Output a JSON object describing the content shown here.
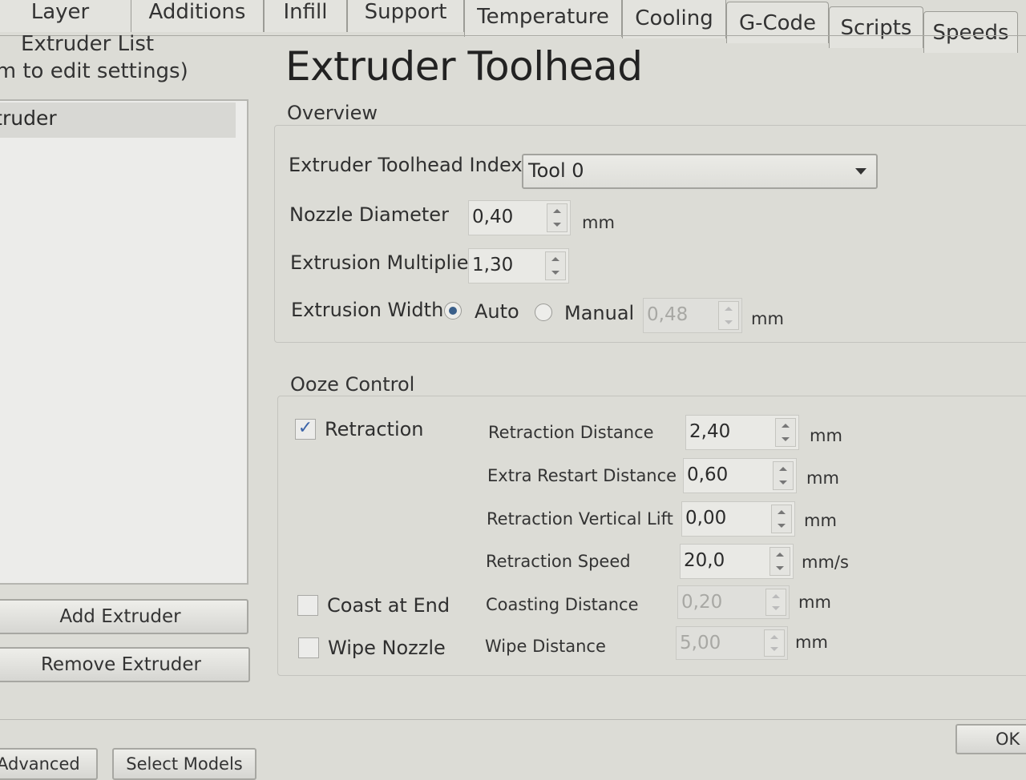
{
  "tabs": [
    {
      "label": "Layer"
    },
    {
      "label": "Additions"
    },
    {
      "label": "Infill"
    },
    {
      "label": "Support"
    },
    {
      "label": "Temperature"
    },
    {
      "label": "Cooling"
    },
    {
      "label": "G-Code"
    },
    {
      "label": "Scripts"
    },
    {
      "label": "Speeds"
    }
  ],
  "left": {
    "title": "Extruder List",
    "hint": "(Click item to edit settings)",
    "items": [
      "Primary Extruder"
    ],
    "add_button": "Add Extruder",
    "remove_button": "Remove Extruder"
  },
  "main": {
    "heading": "Extruder Toolhead",
    "overview": {
      "title": "Overview",
      "toolhead_index_label": "Extruder Toolhead Index",
      "toolhead_index_value": "Tool 0",
      "nozzle_label": "Nozzle Diameter",
      "nozzle_value": "0,40",
      "nozzle_unit": "mm",
      "multiplier_label": "Extrusion Multiplier",
      "multiplier_value": "1,30",
      "width_label": "Extrusion Width",
      "width_auto": "Auto",
      "width_manual": "Manual",
      "width_mode": "Auto",
      "width_value": "0,48",
      "width_unit": "mm"
    },
    "ooze": {
      "title": "Ooze Control",
      "retraction_label": "Retraction",
      "retraction_checked": true,
      "coast_label": "Coast at End",
      "coast_checked": false,
      "wipe_label": "Wipe Nozzle",
      "wipe_checked": false,
      "rows": [
        {
          "label": "Retraction Distance",
          "value": "2,40",
          "unit": "mm"
        },
        {
          "label": "Extra Restart Distance",
          "value": "0,60",
          "unit": "mm"
        },
        {
          "label": "Retraction Vertical Lift",
          "value": "0,00",
          "unit": "mm"
        },
        {
          "label": "Retraction Speed",
          "value": "20,0",
          "unit": "mm/s"
        },
        {
          "label": "Coasting Distance",
          "value": "0,20",
          "unit": "mm"
        },
        {
          "label": "Wipe Distance",
          "value": "5,00",
          "unit": "mm"
        }
      ]
    }
  },
  "bottom": {
    "advanced": "Advanced",
    "select_models": "Select Models",
    "ok": "OK"
  }
}
